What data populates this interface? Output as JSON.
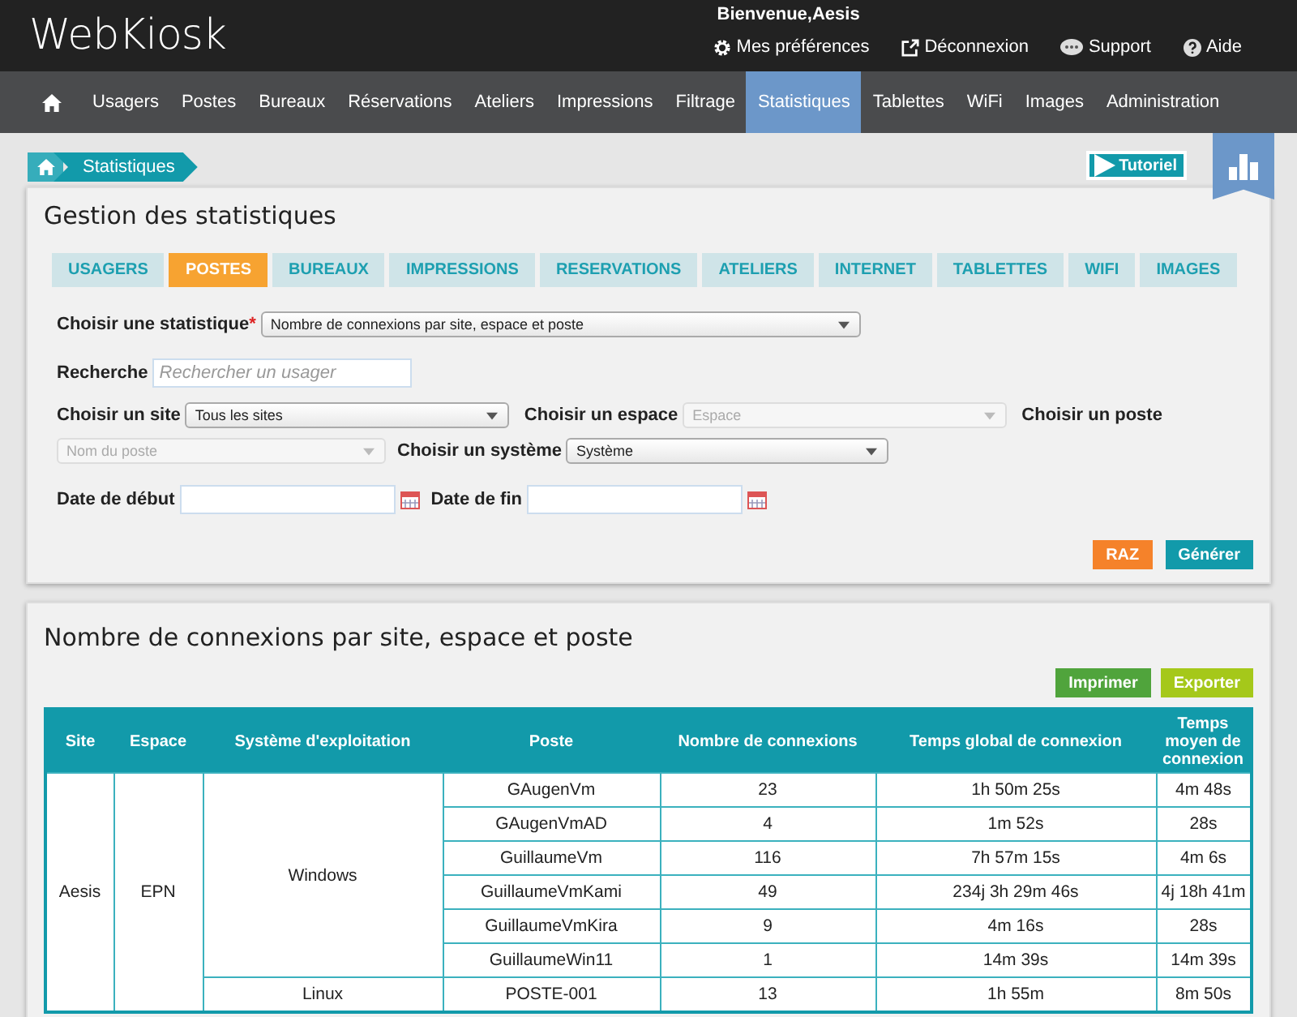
{
  "header": {
    "logo": "WebKiosk",
    "welcome": "Bienvenue,Aesis",
    "links": [
      {
        "kind": "gear",
        "label": "Mes préférences"
      },
      {
        "kind": "external",
        "label": "Déconnexion"
      },
      {
        "kind": "chat",
        "label": "Support"
      },
      {
        "kind": "help",
        "label": "Aide"
      }
    ]
  },
  "nav": [
    {
      "label": "Usagers",
      "selected": false
    },
    {
      "label": "Postes",
      "selected": false
    },
    {
      "label": "Bureaux",
      "selected": false
    },
    {
      "label": "Réservations",
      "selected": false
    },
    {
      "label": "Ateliers",
      "selected": false
    },
    {
      "label": "Impressions",
      "selected": false
    },
    {
      "label": "Filtrage",
      "selected": false
    },
    {
      "label": "Statistiques",
      "selected": true
    },
    {
      "label": "Tablettes",
      "selected": false
    },
    {
      "label": "WiFi",
      "selected": false
    },
    {
      "label": "Images",
      "selected": false
    },
    {
      "label": "Administration",
      "selected": false
    }
  ],
  "breadcrumb": "Statistiques",
  "tutorial": "Tutoriel",
  "form": {
    "title": "Gestion des statistiques",
    "tabs": [
      {
        "label": "USAGERS",
        "selected": false
      },
      {
        "label": "POSTES",
        "selected": true
      },
      {
        "label": "BUREAUX",
        "selected": false
      },
      {
        "label": "IMPRESSIONS",
        "selected": false
      },
      {
        "label": "RESERVATIONS",
        "selected": false
      },
      {
        "label": "ATELIERS",
        "selected": false
      },
      {
        "label": "INTERNET",
        "selected": false
      },
      {
        "label": "TABLETTES",
        "selected": false
      },
      {
        "label": "WIFI",
        "selected": false
      },
      {
        "label": "IMAGES",
        "selected": false
      }
    ],
    "statistic": {
      "label": "Choisir une statistique",
      "required_mark": "*",
      "value": "Nombre de connexions par site, espace et poste"
    },
    "search": {
      "label": "Recherche",
      "placeholder": "Rechercher un usager"
    },
    "site": {
      "label": "Choisir un site",
      "value": "Tous les sites",
      "disabled": false
    },
    "espace": {
      "label": "Choisir un espace",
      "value": "Espace",
      "disabled": true
    },
    "poste": {
      "label": "Choisir un poste",
      "value": "Nom du poste",
      "disabled": true
    },
    "systeme": {
      "label": "Choisir un système",
      "value": "Système",
      "disabled": false
    },
    "start": {
      "label": "Date de début"
    },
    "end": {
      "label": "Date de fin"
    },
    "reset": "RAZ",
    "generate": "Générer"
  },
  "results": {
    "title": "Nombre de connexions par site, espace et poste",
    "print": "Imprimer",
    "export": "Exporter",
    "columns": [
      "Site",
      "Espace",
      "Système d'exploitation",
      "Poste",
      "Nombre de connexions",
      "Temps global de connexion",
      "Temps moyen de connexion"
    ],
    "sites": [
      {
        "name": "Aesis",
        "espaces": [
          {
            "name": "EPN",
            "systems": [
              {
                "name": "Windows",
                "postes": [
                  [
                    "GAugenVm",
                    "23",
                    "1h 50m 25s",
                    "4m 48s"
                  ],
                  [
                    "GAugenVmAD",
                    "4",
                    "1m 52s",
                    "28s"
                  ],
                  [
                    "GuillaumeVm",
                    "116",
                    "7h 57m 15s",
                    "4m 6s"
                  ],
                  [
                    "GuillaumeVmKami",
                    "49",
                    "234j 3h 29m 46s",
                    "4j 18h 41m"
                  ],
                  [
                    "GuillaumeVmKira",
                    "9",
                    "4m 16s",
                    "28s"
                  ],
                  [
                    "GuillaumeWin11",
                    "1",
                    "14m 39s",
                    "14m 39s"
                  ]
                ]
              },
              {
                "name": "Linux",
                "postes": [
                  [
                    "POSTE-001",
                    "13",
                    "1h 55m",
                    "8m 50s"
                  ]
                ]
              }
            ]
          }
        ]
      }
    ]
  }
}
